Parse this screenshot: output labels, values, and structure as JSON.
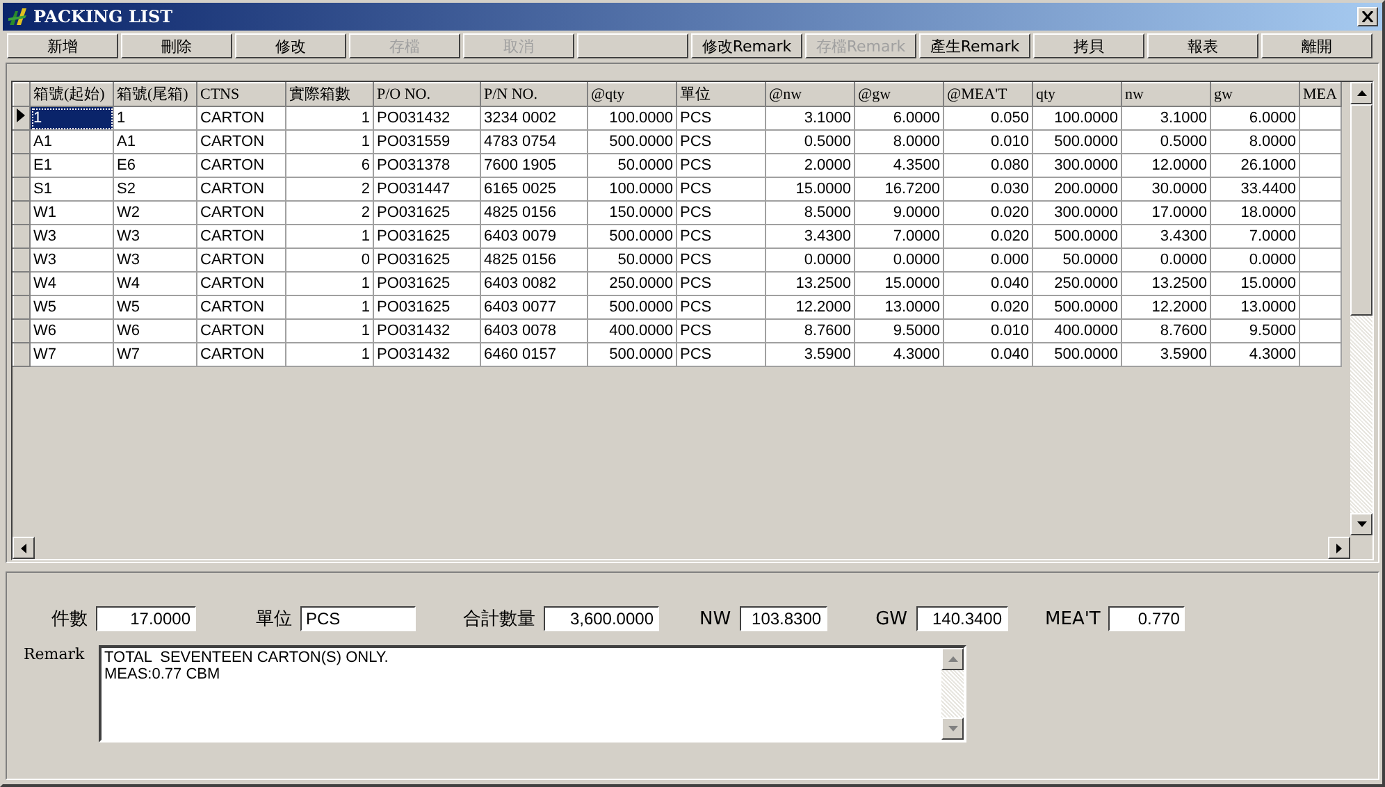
{
  "window": {
    "title": "PACKING LIST"
  },
  "toolbar": [
    {
      "kind": "text",
      "label": "新增",
      "disabled": false
    },
    {
      "kind": "text",
      "label": "刪除",
      "disabled": false
    },
    {
      "kind": "text",
      "label": "修改",
      "disabled": false
    },
    {
      "kind": "text",
      "label": "存檔",
      "disabled": true
    },
    {
      "kind": "text",
      "label": "取消",
      "disabled": true
    },
    {
      "kind": "blank"
    },
    {
      "kind": "text",
      "label": "修改Remark",
      "disabled": false
    },
    {
      "kind": "text",
      "label": "存檔Remark",
      "disabled": true
    },
    {
      "kind": "text",
      "label": "產生Remark",
      "disabled": false
    },
    {
      "kind": "text",
      "label": "拷貝",
      "disabled": false
    },
    {
      "kind": "text",
      "label": "報表",
      "disabled": false
    },
    {
      "kind": "text",
      "label": "離開",
      "disabled": false
    }
  ],
  "table": {
    "columns": [
      {
        "label": "箱號(起始)",
        "kind": "text"
      },
      {
        "label": "箱號(尾箱)",
        "kind": "text"
      },
      {
        "label": "CTNS",
        "kind": "text"
      },
      {
        "label": "實際箱數",
        "kind": "number"
      },
      {
        "label": "P/O NO.",
        "kind": "text"
      },
      {
        "label": "P/N NO.",
        "kind": "text"
      },
      {
        "label": "@qty",
        "kind": "number"
      },
      {
        "label": "單位",
        "kind": "text"
      },
      {
        "label": "@nw",
        "kind": "number"
      },
      {
        "label": "@gw",
        "kind": "number"
      },
      {
        "label": "@MEA'T",
        "kind": "number"
      },
      {
        "label": "qty",
        "kind": "number"
      },
      {
        "label": "nw",
        "kind": "number"
      },
      {
        "label": "gw",
        "kind": "number"
      },
      {
        "label": "MEA",
        "kind": "number"
      }
    ],
    "rows": [
      {
        "selected": true,
        "cells": [
          "1",
          "1",
          "CARTON",
          "1",
          "PO031432",
          "3234 0002",
          "100.0000",
          "PCS",
          "3.1000",
          "6.0000",
          "0.050",
          "100.0000",
          "3.1000",
          "6.0000"
        ]
      },
      {
        "selected": false,
        "cells": [
          "A1",
          "A1",
          "CARTON",
          "1",
          "PO031559",
          "4783 0754",
          "500.0000",
          "PCS",
          "0.5000",
          "8.0000",
          "0.010",
          "500.0000",
          "0.5000",
          "8.0000"
        ]
      },
      {
        "selected": false,
        "cells": [
          "E1",
          "E6",
          "CARTON",
          "6",
          "PO031378",
          "7600 1905",
          "50.0000",
          "PCS",
          "2.0000",
          "4.3500",
          "0.080",
          "300.0000",
          "12.0000",
          "26.1000"
        ]
      },
      {
        "selected": false,
        "cells": [
          "S1",
          "S2",
          "CARTON",
          "2",
          "PO031447",
          "6165 0025",
          "100.0000",
          "PCS",
          "15.0000",
          "16.7200",
          "0.030",
          "200.0000",
          "30.0000",
          "33.4400"
        ]
      },
      {
        "selected": false,
        "cells": [
          "W1",
          "W2",
          "CARTON",
          "2",
          "PO031625",
          "4825 0156",
          "150.0000",
          "PCS",
          "8.5000",
          "9.0000",
          "0.020",
          "300.0000",
          "17.0000",
          "18.0000"
        ]
      },
      {
        "selected": false,
        "cells": [
          "W3",
          "W3",
          "CARTON",
          "1",
          "PO031625",
          "6403 0079",
          "500.0000",
          "PCS",
          "3.4300",
          "7.0000",
          "0.020",
          "500.0000",
          "3.4300",
          "7.0000"
        ]
      },
      {
        "selected": false,
        "cells": [
          "W3",
          "W3",
          "CARTON",
          "0",
          "PO031625",
          "4825 0156",
          "50.0000",
          "PCS",
          "0.0000",
          "0.0000",
          "0.000",
          "50.0000",
          "0.0000",
          "0.0000"
        ]
      },
      {
        "selected": false,
        "cells": [
          "W4",
          "W4",
          "CARTON",
          "1",
          "PO031625",
          "6403 0082",
          "250.0000",
          "PCS",
          "13.2500",
          "15.0000",
          "0.040",
          "250.0000",
          "13.2500",
          "15.0000"
        ]
      },
      {
        "selected": false,
        "cells": [
          "W5",
          "W5",
          "CARTON",
          "1",
          "PO031625",
          "6403 0077",
          "500.0000",
          "PCS",
          "12.2000",
          "13.0000",
          "0.020",
          "500.0000",
          "12.2000",
          "13.0000"
        ]
      },
      {
        "selected": false,
        "cells": [
          "W6",
          "W6",
          "CARTON",
          "1",
          "PO031432",
          "6403 0078",
          "400.0000",
          "PCS",
          "8.7600",
          "9.5000",
          "0.010",
          "400.0000",
          "8.7600",
          "9.5000"
        ]
      },
      {
        "selected": false,
        "cells": [
          "W7",
          "W7",
          "CARTON",
          "1",
          "PO031432",
          "6460 0157",
          "500.0000",
          "PCS",
          "3.5900",
          "4.3000",
          "0.040",
          "500.0000",
          "3.5900",
          "4.3000"
        ]
      }
    ]
  },
  "totals": [
    {
      "label": "件數",
      "value": "17.0000",
      "kind": "number"
    },
    {
      "label": "單位",
      "value": "PCS",
      "kind": "text"
    },
    {
      "label": "合計數量",
      "value": "3,600.0000",
      "kind": "number"
    },
    {
      "label": "NW",
      "value": "103.8300",
      "kind": "number"
    },
    {
      "label": "GW",
      "value": "140.3400",
      "kind": "number"
    },
    {
      "label": "MEA'T",
      "value": "0.770",
      "kind": "number"
    }
  ],
  "remark": {
    "label": "Remark",
    "lines": [
      "TOTAL  SEVENTEEN CARTON(S) ONLY.",
      "MEAS:0.77 CBM"
    ]
  }
}
